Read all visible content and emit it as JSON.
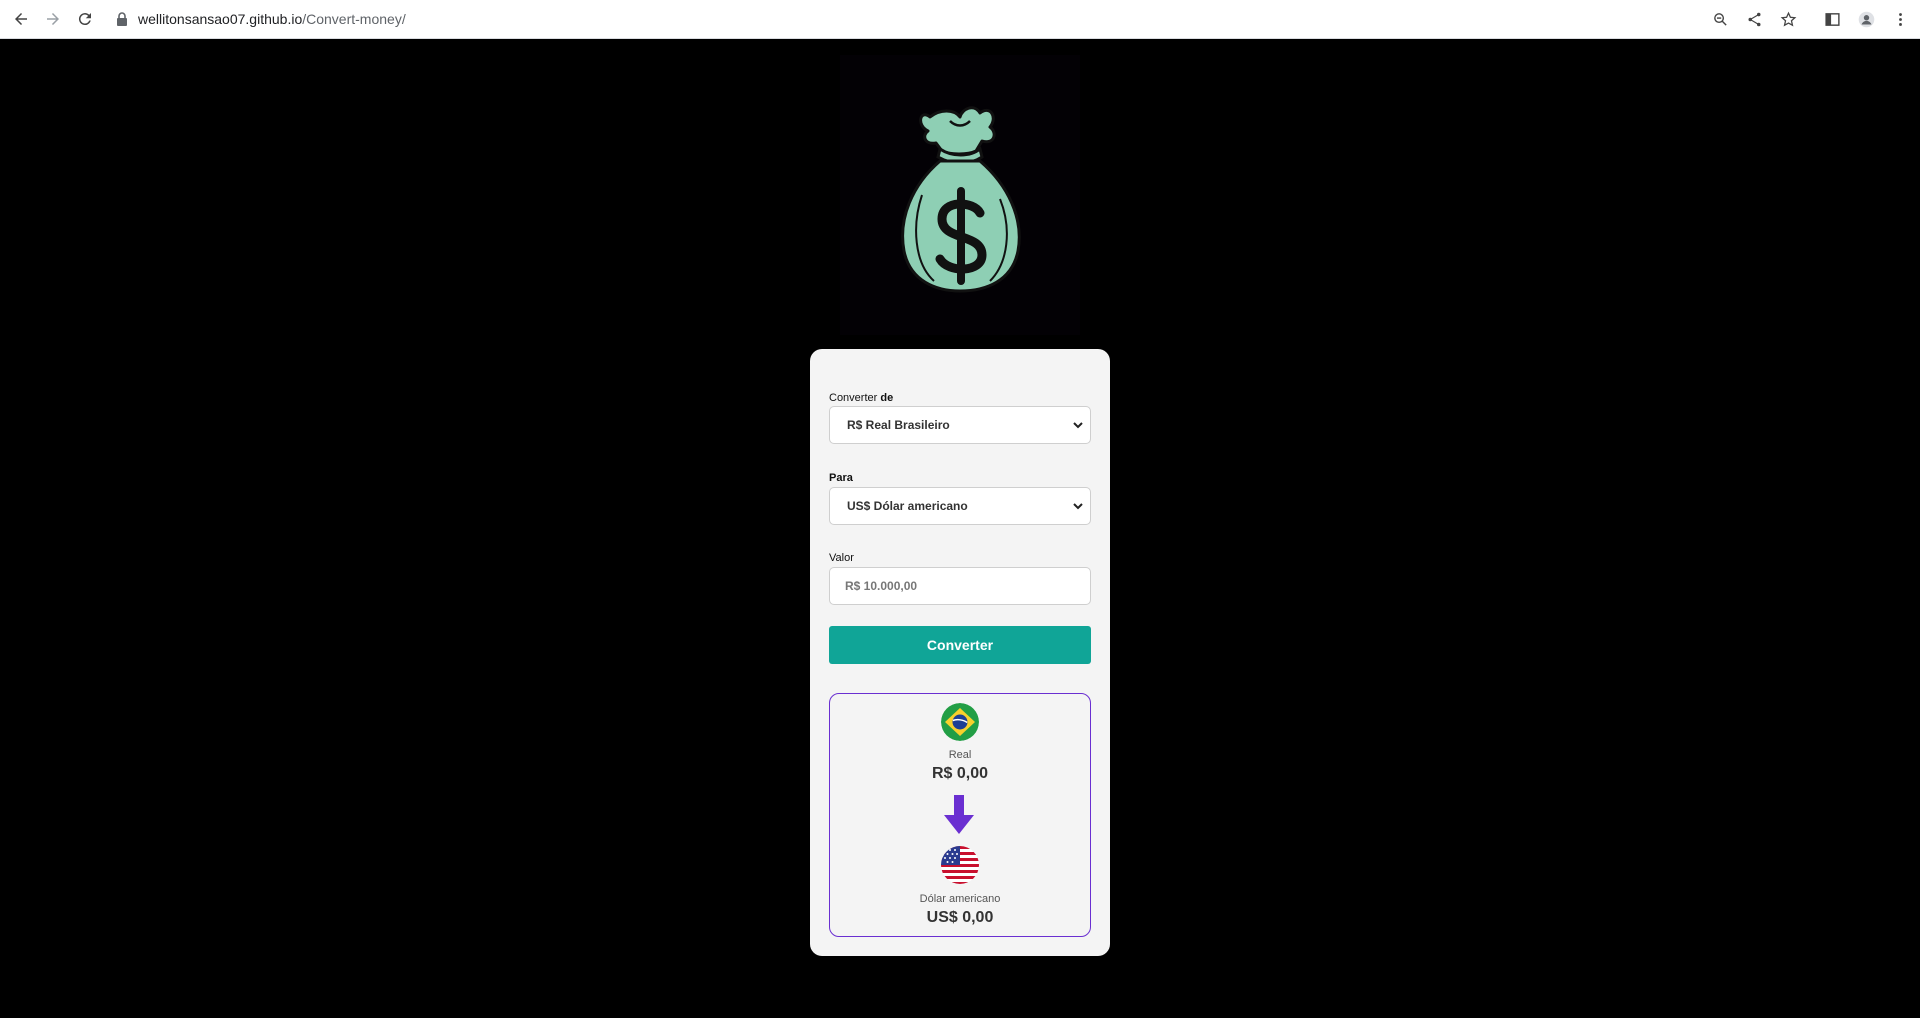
{
  "browser": {
    "url_host": "wellitonsansao07.github.io",
    "url_path": "/Convert-money/"
  },
  "form": {
    "from_label_prefix": "Converter ",
    "from_label_bold": "de",
    "from_select_value": "R$ Real Brasileiro",
    "to_label": "Para",
    "to_select_value": "US$ Dólar americano",
    "value_label": "Valor",
    "value_placeholder": "R$ 10.000,00",
    "convert_button": "Converter"
  },
  "result": {
    "from_currency_name": "Real",
    "from_currency_value": "R$ 0,00",
    "to_currency_name": "Dólar americano",
    "to_currency_value": "US$ 0,00"
  },
  "colors": {
    "background": "#000000",
    "accent_button": "#10a597",
    "result_border": "#6a2fd1",
    "arrow": "#6a2fd1",
    "money_bag": "#8ecfb4"
  }
}
